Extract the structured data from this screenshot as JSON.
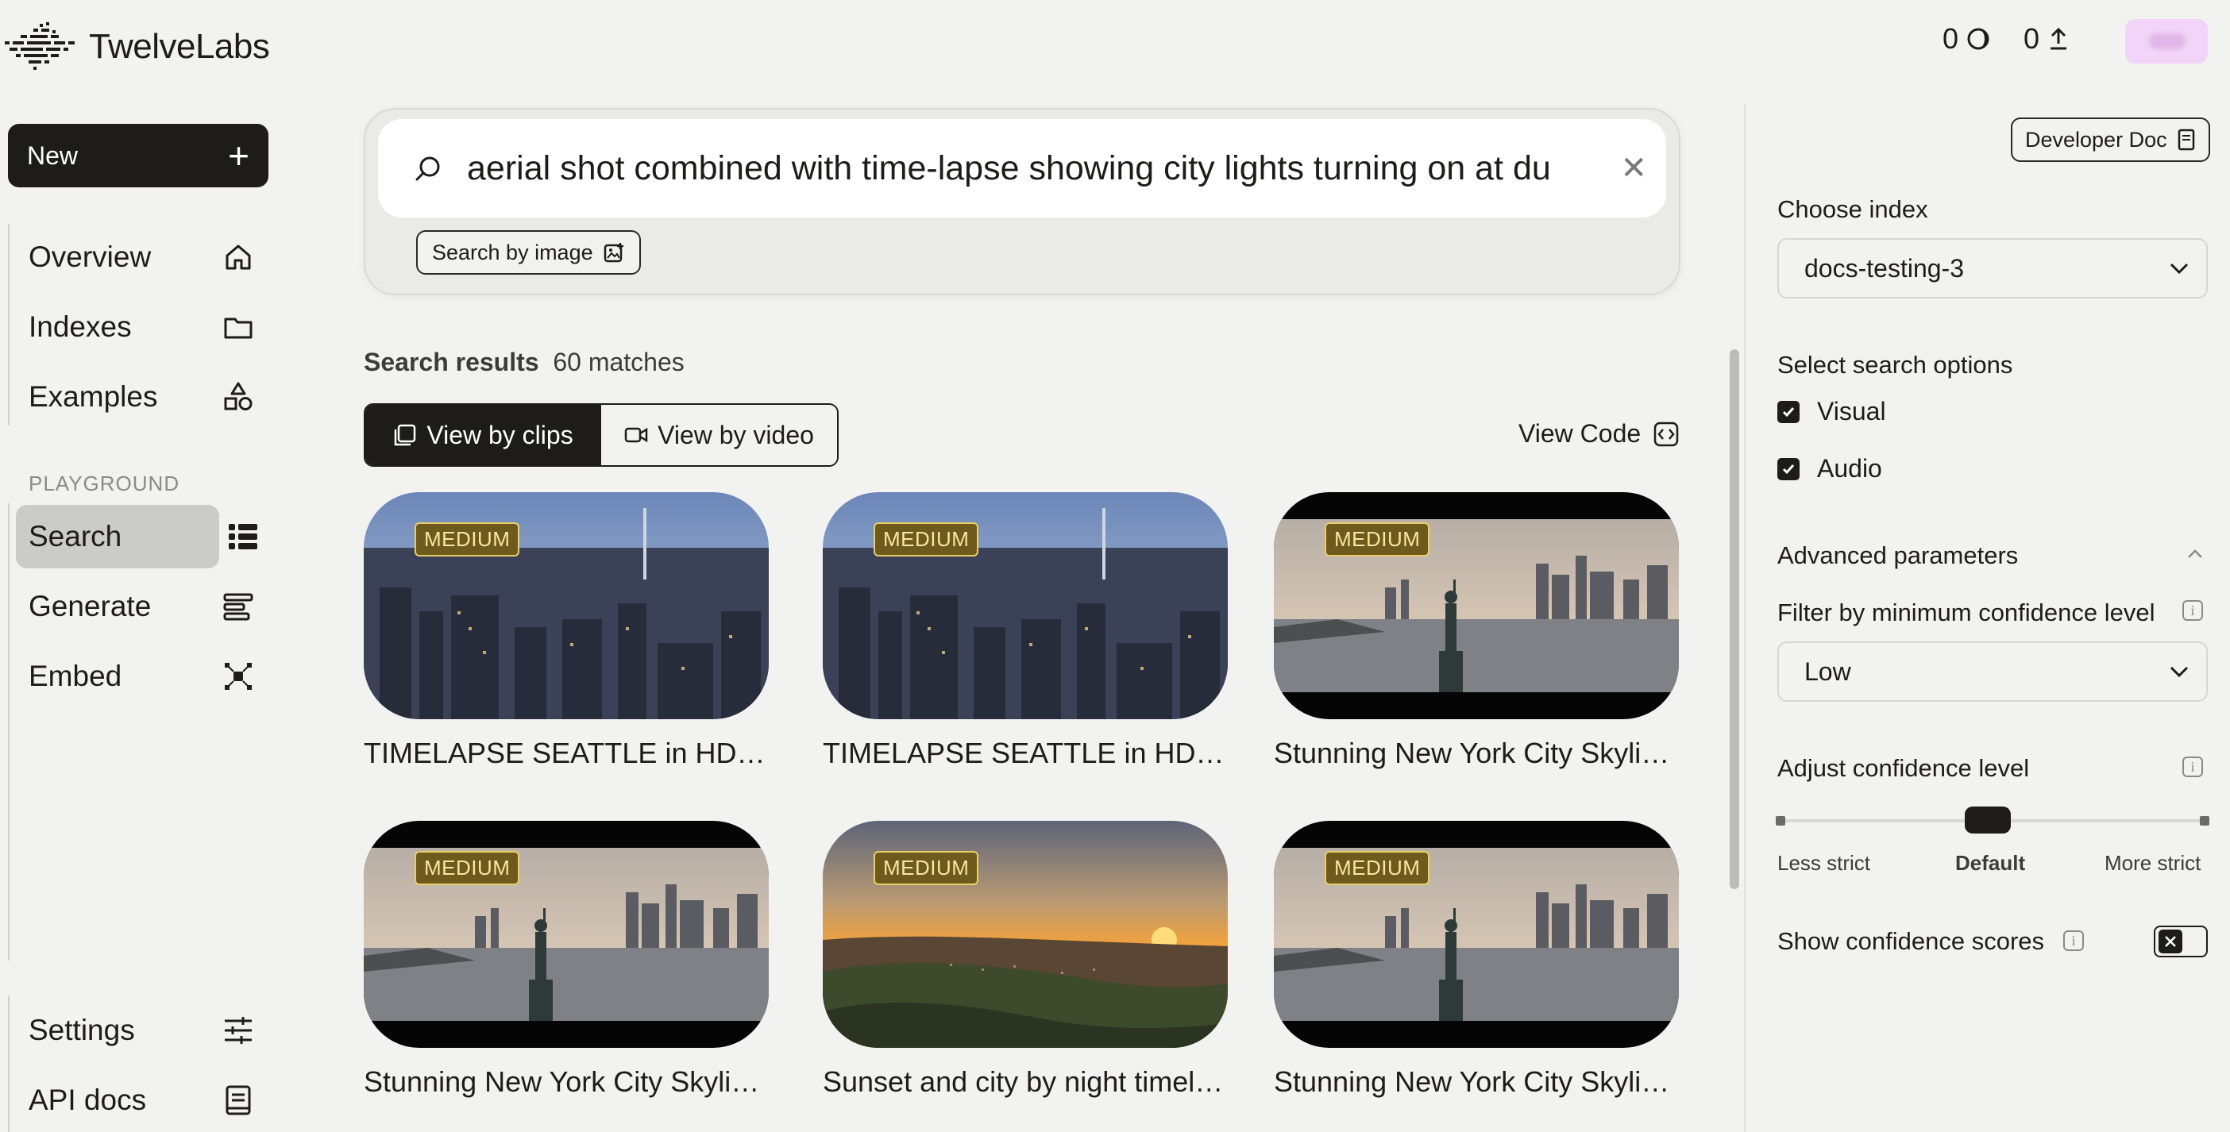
{
  "app": {
    "brand": "TwelveLabs",
    "credits": [
      {
        "value": "0",
        "icon": "half-moon-icon"
      },
      {
        "value": "0",
        "icon": "upload-arrow-icon"
      }
    ]
  },
  "sidebar": {
    "new_label": "New",
    "nav_top": [
      {
        "label": "Overview",
        "icon": "home-icon"
      },
      {
        "label": "Indexes",
        "icon": "folder-icon"
      },
      {
        "label": "Examples",
        "icon": "shapes-icon"
      }
    ],
    "playground_label": "PLAYGROUND",
    "nav_playground": [
      {
        "label": "Search",
        "icon": "search-grid-icon",
        "active": true
      },
      {
        "label": "Generate",
        "icon": "generate-lines-icon"
      },
      {
        "label": "Embed",
        "icon": "embed-dots-icon"
      }
    ],
    "nav_bottom": [
      {
        "label": "Settings",
        "icon": "sliders-icon"
      },
      {
        "label": "API docs",
        "icon": "book-icon"
      }
    ]
  },
  "search": {
    "query": "aerial shot combined with time-lapse showing city lights turning on at du",
    "image_button": "Search by image"
  },
  "results": {
    "label": "Search results",
    "count": "60 matches",
    "view_by_clips": "View by clips",
    "view_by_video": "View by video",
    "view_code": "View Code",
    "items": [
      {
        "badge": "MEDIUM",
        "title": "TIMELAPSE SEATTLE in HD - ...",
        "scene": "seattle"
      },
      {
        "badge": "MEDIUM",
        "title": "TIMELAPSE SEATTLE in HD - ...",
        "scene": "seattle"
      },
      {
        "badge": "MEDIUM",
        "title": "Stunning New York City Skylin...",
        "scene": "nyc"
      },
      {
        "badge": "MEDIUM",
        "title": "Stunning New York City Skylin...",
        "scene": "nyc"
      },
      {
        "badge": "MEDIUM",
        "title": "Sunset and city by night timela...",
        "scene": "sunset"
      },
      {
        "badge": "MEDIUM",
        "title": "Stunning New York City Skylin...",
        "scene": "nyc"
      }
    ]
  },
  "panel": {
    "developer_doc": "Developer Doc",
    "choose_index_label": "Choose index",
    "index_value": "docs-testing-3",
    "search_options_label": "Select search options",
    "options": [
      {
        "label": "Visual",
        "checked": true
      },
      {
        "label": "Audio",
        "checked": true
      }
    ],
    "advanced_label": "Advanced parameters",
    "filter_label": "Filter by minimum confidence level",
    "filter_value": "Low",
    "adjust_label": "Adjust confidence level",
    "slider_position": 0.5,
    "slider_left": "Less strict",
    "slider_mid": "Default",
    "slider_right": "More strict",
    "show_scores_label": "Show confidence scores",
    "show_scores_on": false
  },
  "colors": {
    "background": "#f2f2f1",
    "dark": "#1d1c1b",
    "badge_bg": "#6e5a1c",
    "badge_text": "#f7e7a0",
    "avatar": "#f2d4f8"
  }
}
